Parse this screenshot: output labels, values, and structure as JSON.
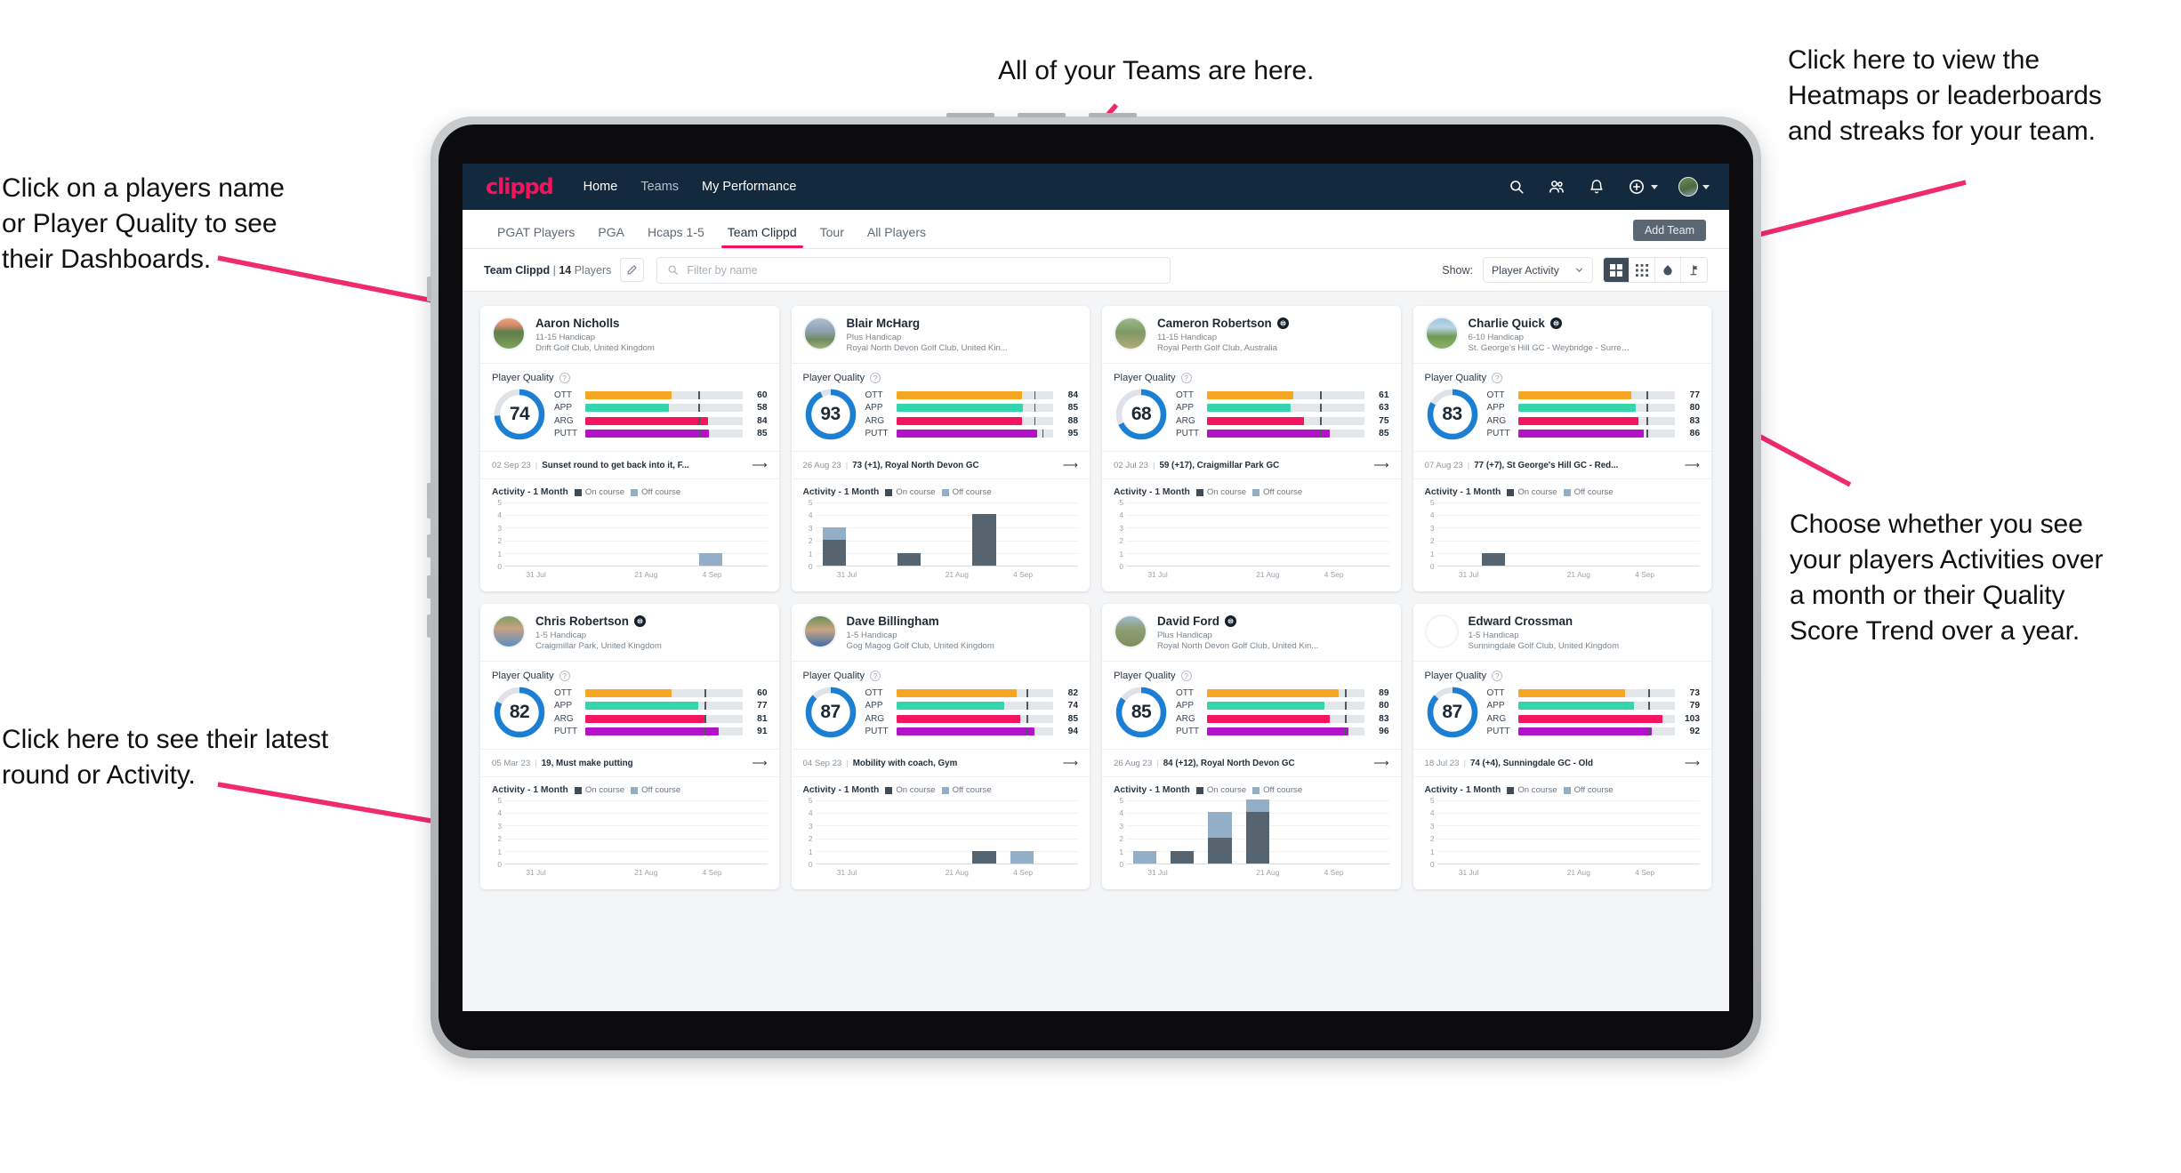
{
  "annotations": {
    "top_center": "All of your Teams are here.",
    "top_right": "Click here to view the\nHeatmaps or leaderboards\nand streaks for your team.",
    "left_top": "Click on a players name\nor Player Quality to see\ntheir Dashboards.",
    "right_mid": "Choose whether you see\nyour players Activities over\na month or their Quality\nScore Trend over a year.",
    "left_bottom": "Click here to see their latest\nround or Activity.",
    "arrow_color": "#ef2b6a"
  },
  "app": {
    "logo": "clippd",
    "nav": [
      {
        "label": "Home",
        "active": true
      },
      {
        "label": "Teams",
        "active": false
      },
      {
        "label": "My Performance",
        "active": true
      }
    ],
    "header_icons": [
      {
        "name": "search-icon"
      },
      {
        "name": "people-icon"
      },
      {
        "name": "bell-icon"
      },
      {
        "name": "plus-circle-icon"
      }
    ],
    "tabs": [
      {
        "label": "PGAT Players",
        "active": false
      },
      {
        "label": "PGA",
        "active": false
      },
      {
        "label": "Hcaps 1-5",
        "active": false
      },
      {
        "label": "Team Clippd",
        "active": true
      },
      {
        "label": "Tour",
        "active": false
      },
      {
        "label": "All Players",
        "active": false
      }
    ],
    "add_team_label": "Add Team",
    "toolbar": {
      "team_name": "Team Clippd",
      "separator": "|",
      "player_count": "14",
      "players_word": "Players",
      "edit_icon": "pencil-icon",
      "search_placeholder": "Filter by name",
      "show_label": "Show:",
      "show_value": "Player Activity",
      "view_buttons": [
        {
          "name": "grid-large-icon",
          "active": true
        },
        {
          "name": "grid-small-icon",
          "active": false
        },
        {
          "name": "heatmap-icon",
          "active": false
        },
        {
          "name": "leaderboard-icon",
          "active": false
        }
      ]
    },
    "card_labels": {
      "player_quality": "Player Quality",
      "activity": "Activity - 1 Month",
      "legend_on": "On course",
      "legend_off": "Off course",
      "help_icon": "question-icon",
      "arrow_icon": "arrow-right-icon"
    },
    "metric_colors": {
      "OTT": "#f5a623",
      "APP": "#34d4ac",
      "ARG": "#f5155e",
      "PUTT": "#b312c9",
      "ring": "#1b7fd4",
      "ring_track": "#dfe3e7"
    }
  },
  "chart_data": {
    "type": "bar",
    "title": "Activity - 1 Month",
    "ylabel": "",
    "xlabel": "",
    "ylim": [
      0,
      5
    ],
    "yticks": [
      0,
      1,
      2,
      3,
      4,
      5
    ],
    "x_tick_labels": [
      "31 Jul",
      "21 Aug",
      "4 Sep"
    ],
    "legend": [
      "On course",
      "Off course"
    ],
    "grid": true,
    "stacked": true
  },
  "players": [
    {
      "name": "Aaron Nicholls",
      "verified": false,
      "handicap": "11-15 Handicap",
      "club": "Drift Golf Club, United Kingdom",
      "quality": 74,
      "metrics": [
        {
          "label": "OTT",
          "value": 60,
          "bar": 55,
          "tick": 72
        },
        {
          "label": "APP",
          "value": 58,
          "bar": 53,
          "tick": 72
        },
        {
          "label": "ARG",
          "value": 84,
          "bar": 78,
          "tick": 72
        },
        {
          "label": "PUTT",
          "value": 85,
          "bar": 79,
          "tick": 72
        }
      ],
      "round_date": "02 Sep 23",
      "round_text": "Sunset round to get back into it, F...",
      "activity": {
        "on": [
          0,
          0,
          0,
          0,
          0,
          0,
          0
        ],
        "off": [
          0,
          0,
          0,
          0,
          0,
          1,
          0
        ]
      },
      "avatar": "golf-course-sunset"
    },
    {
      "name": "Blair McHarg",
      "verified": false,
      "handicap": "Plus Handicap",
      "club": "Royal North Devon Golf Club, United Kin...",
      "quality": 93,
      "metrics": [
        {
          "label": "OTT",
          "value": 84,
          "bar": 80,
          "tick": 88
        },
        {
          "label": "APP",
          "value": 85,
          "bar": 81,
          "tick": 88
        },
        {
          "label": "ARG",
          "value": 88,
          "bar": 80,
          "tick": 88
        },
        {
          "label": "PUTT",
          "value": 95,
          "bar": 90,
          "tick": 93
        }
      ],
      "round_date": "26 Aug 23",
      "round_text": "73 (+1), Royal North Devon GC",
      "activity": {
        "on": [
          2,
          0,
          1,
          0,
          4,
          0,
          0
        ],
        "off": [
          1,
          0,
          0,
          0,
          0,
          0,
          0
        ]
      },
      "avatar": "clubhouse"
    },
    {
      "name": "Cameron Robertson",
      "verified": true,
      "handicap": "11-15 Handicap",
      "club": "Royal Perth Golf Club, Australia",
      "quality": 68,
      "metrics": [
        {
          "label": "OTT",
          "value": 61,
          "bar": 55,
          "tick": 72
        },
        {
          "label": "APP",
          "value": 63,
          "bar": 53,
          "tick": 72
        },
        {
          "label": "ARG",
          "value": 75,
          "bar": 62,
          "tick": 72
        },
        {
          "label": "PUTT",
          "value": 85,
          "bar": 78,
          "tick": 72
        }
      ],
      "round_date": "02 Jul 23",
      "round_text": "59 (+17), Craigmillar Park GC",
      "activity": {
        "on": [
          0,
          0,
          0,
          0,
          0,
          0,
          0
        ],
        "off": [
          0,
          0,
          0,
          0,
          0,
          0,
          0
        ]
      },
      "avatar": "golfer-fairway"
    },
    {
      "name": "Charlie Quick",
      "verified": true,
      "handicap": "6-10 Handicap",
      "club": "St. George's Hill GC - Weybridge - Surrey, ...",
      "quality": 83,
      "metrics": [
        {
          "label": "OTT",
          "value": 77,
          "bar": 72,
          "tick": 82
        },
        {
          "label": "APP",
          "value": 80,
          "bar": 75,
          "tick": 82
        },
        {
          "label": "ARG",
          "value": 83,
          "bar": 77,
          "tick": 82
        },
        {
          "label": "PUTT",
          "value": 86,
          "bar": 80,
          "tick": 82
        }
      ],
      "round_date": "07 Aug 23",
      "round_text": "77 (+7), St George's Hill GC - Red...",
      "activity": {
        "on": [
          0,
          1,
          0,
          0,
          0,
          0,
          0
        ],
        "off": [
          0,
          0,
          0,
          0,
          0,
          0,
          0
        ]
      },
      "avatar": "green-path"
    },
    {
      "name": "Chris Robertson",
      "verified": true,
      "handicap": "1-5 Handicap",
      "club": "Craigmillar Park, United Kingdom",
      "quality": 82,
      "metrics": [
        {
          "label": "OTT",
          "value": 60,
          "bar": 55,
          "tick": 76
        },
        {
          "label": "APP",
          "value": 77,
          "bar": 72,
          "tick": 76
        },
        {
          "label": "ARG",
          "value": 81,
          "bar": 76,
          "tick": 76
        },
        {
          "label": "PUTT",
          "value": 91,
          "bar": 85,
          "tick": 76
        }
      ],
      "round_date": "05 Mar 23",
      "round_text": "19, Must make putting",
      "activity": {
        "on": [
          0,
          0,
          0,
          0,
          0,
          0,
          0
        ],
        "off": [
          0,
          0,
          0,
          0,
          0,
          0,
          0
        ]
      },
      "avatar": "man-blue-shirt"
    },
    {
      "name": "Dave Billingham",
      "verified": false,
      "handicap": "1-5 Handicap",
      "club": "Gog Magog Golf Club, United Kingdom",
      "quality": 87,
      "metrics": [
        {
          "label": "OTT",
          "value": 82,
          "bar": 77,
          "tick": 83
        },
        {
          "label": "APP",
          "value": 74,
          "bar": 69,
          "tick": 83
        },
        {
          "label": "ARG",
          "value": 85,
          "bar": 79,
          "tick": 83
        },
        {
          "label": "PUTT",
          "value": 94,
          "bar": 88,
          "tick": 83
        }
      ],
      "round_date": "04 Sep 23",
      "round_text": "Mobility with coach, Gym",
      "activity": {
        "on": [
          0,
          0,
          0,
          0,
          1,
          0,
          0
        ],
        "off": [
          0,
          0,
          0,
          0,
          0,
          1,
          0
        ]
      },
      "avatar": "man-beard"
    },
    {
      "name": "David Ford",
      "verified": true,
      "handicap": "Plus Handicap",
      "club": "Royal North Devon Golf Club, United Kin...",
      "quality": 85,
      "metrics": [
        {
          "label": "OTT",
          "value": 89,
          "bar": 84,
          "tick": 88
        },
        {
          "label": "APP",
          "value": 80,
          "bar": 75,
          "tick": 88
        },
        {
          "label": "ARG",
          "value": 83,
          "bar": 78,
          "tick": 88
        },
        {
          "label": "PUTT",
          "value": 96,
          "bar": 90,
          "tick": 88
        }
      ],
      "round_date": "26 Aug 23",
      "round_text": "84 (+12), Royal North Devon GC",
      "activity": {
        "on": [
          0,
          1,
          2,
          4,
          0,
          0,
          0
        ],
        "off": [
          1,
          0,
          2,
          1,
          0,
          0,
          0
        ]
      },
      "avatar": "golfer-hill"
    },
    {
      "name": "Edward Crossman",
      "verified": false,
      "handicap": "1-5 Handicap",
      "club": "Sunningdale Golf Club, United Kingdom",
      "quality": 87,
      "metrics": [
        {
          "label": "OTT",
          "value": 73,
          "bar": 68,
          "tick": 83
        },
        {
          "label": "APP",
          "value": 79,
          "bar": 74,
          "tick": 83
        },
        {
          "label": "ARG",
          "value": 103,
          "bar": 92,
          "tick": 100
        },
        {
          "label": "PUTT",
          "value": 92,
          "bar": 85,
          "tick": 83
        }
      ],
      "round_date": "18 Jul 23",
      "round_text": "74 (+4), Sunningdale GC - Old",
      "activity": {
        "on": [
          0,
          0,
          0,
          0,
          0,
          0,
          0
        ],
        "off": [
          0,
          0,
          0,
          0,
          0,
          0,
          0
        ]
      },
      "avatar": "indoor-group"
    }
  ]
}
